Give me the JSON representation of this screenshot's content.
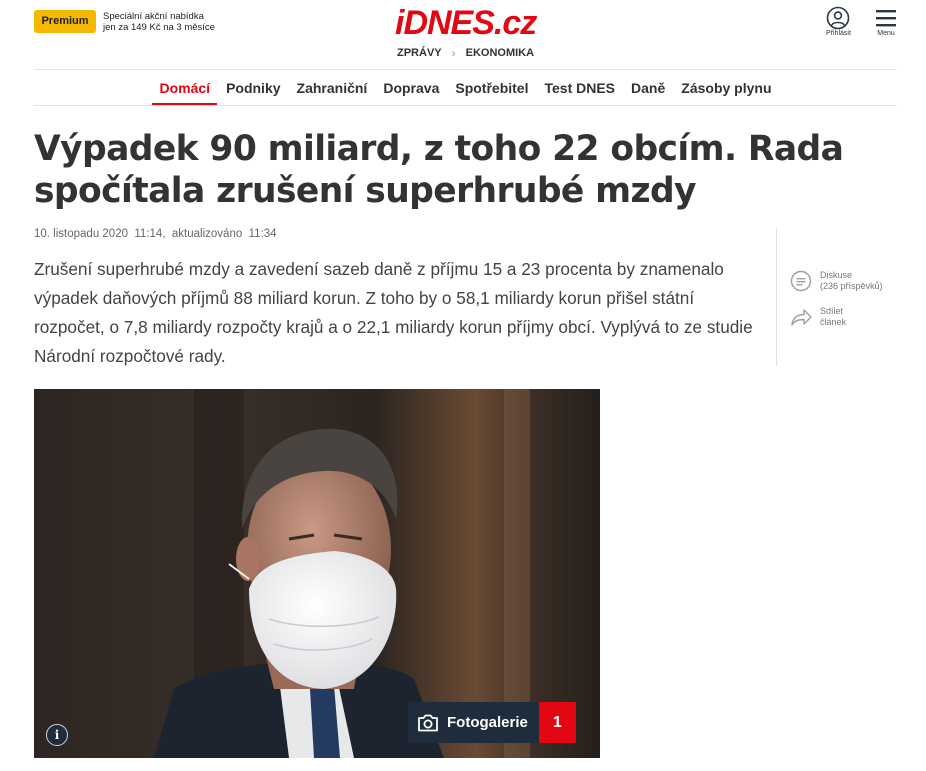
{
  "header": {
    "premium_label": "Premium",
    "promo_line1": "Speciální akční nabídka",
    "promo_line2": "jen za 149 Kč na 3 měsíce",
    "logo": "iDNES.cz",
    "breadcrumbs": [
      "ZPRÁVY",
      "EKONOMIKA"
    ],
    "login_label": "Přihlásit",
    "menu_label": "Menu"
  },
  "nav": {
    "items": [
      "Domácí",
      "Podniky",
      "Zahraniční",
      "Doprava",
      "Spotřebitel",
      "Test DNES",
      "Daně",
      "Zásoby plynu"
    ],
    "active": "Domácí"
  },
  "article": {
    "title": "Výpadek 90 miliard, z toho 22 obcím. Rada spočítala zrušení superhrubé mzdy",
    "date": "10. listopadu 2020",
    "time": "11:14,",
    "updated_label": "aktualizováno",
    "updated_time": "11:34",
    "perex": "Zrušení superhrubé mzdy a zavedení sazeb daně z příjmu 15 a 23 procenta by znamenalo výpadek daňových příjmů 88 miliard korun. Z toho by o 58,1 miliardy korun přišel státní rozpočet, o 7,8 miliardy rozpočty krajů a o 22,1 miliardy korun příjmy obcí. Vyplývá to ze studie Národní rozpočtové rady."
  },
  "sidebar": {
    "discussion_label": "Diskuse",
    "discussion_count": "(236 příspěvků)",
    "share_line1": "Sdílet",
    "share_line2": "článek"
  },
  "photo": {
    "gallery_label": "Fotogalerie",
    "gallery_count": "1",
    "info_icon_text": "i"
  },
  "colors": {
    "brand_red": "#e30613",
    "premium_yellow": "#f5b800",
    "gallery_navy": "#1f2c3b"
  }
}
